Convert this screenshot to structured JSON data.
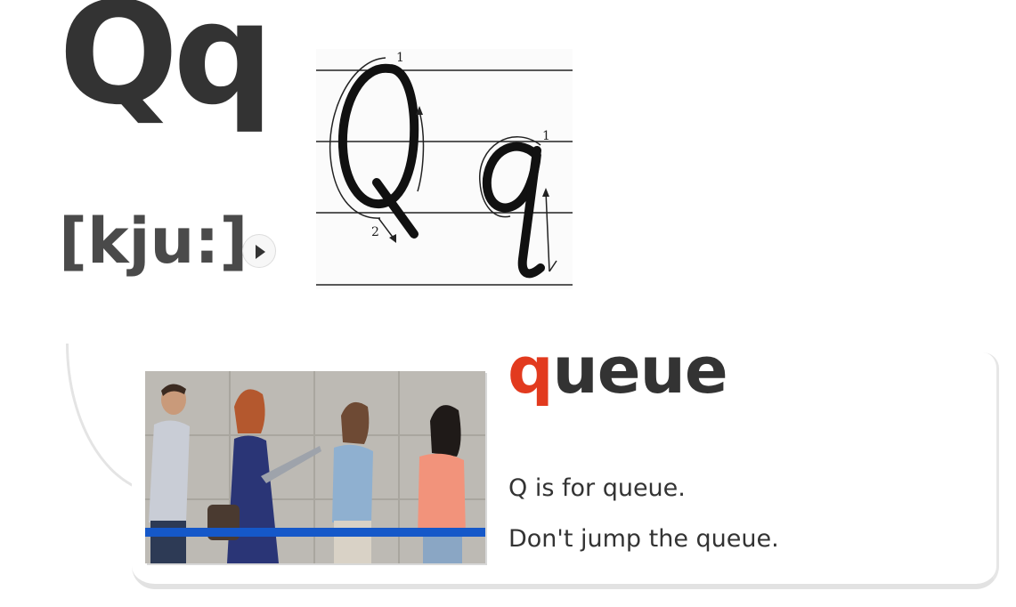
{
  "letter": {
    "upper_lower": "Qq",
    "phonetic": "[kju:]",
    "play_icon": "play-icon"
  },
  "handwriting": {
    "stroke_numbers": [
      "1",
      "2",
      "1"
    ]
  },
  "word_card": {
    "word_first_letter": "q",
    "word_rest": "ueue",
    "sentences": [
      "Q is for queue.",
      "Don't jump the queue."
    ],
    "highlight_color": "#e23a1e",
    "text_color": "#333333"
  }
}
